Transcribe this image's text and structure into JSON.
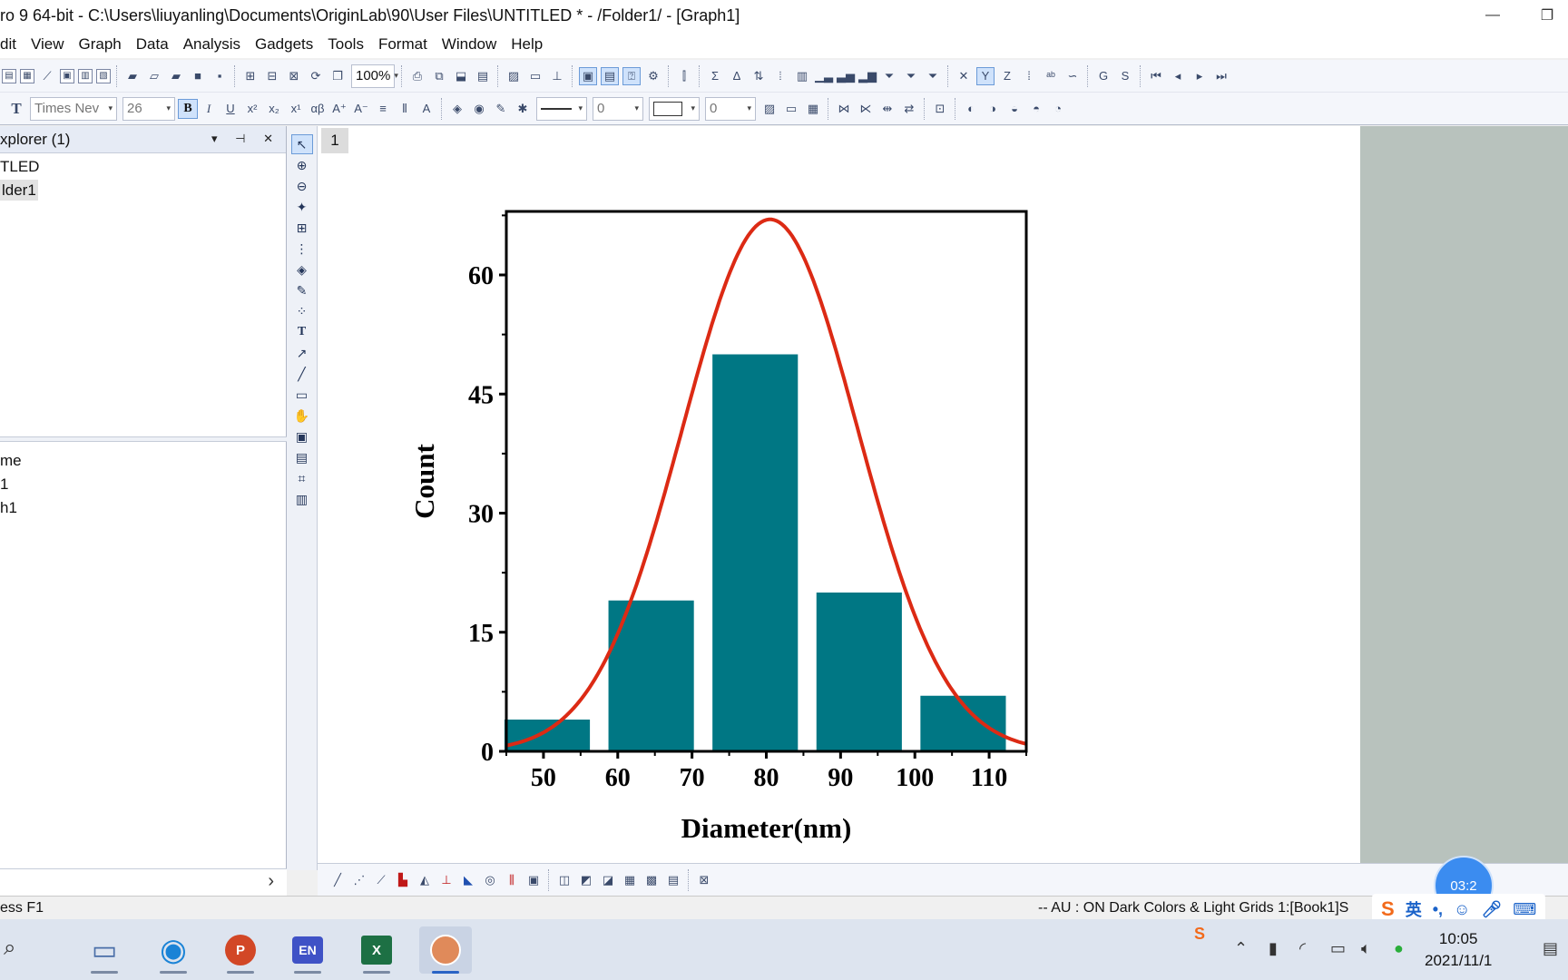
{
  "window": {
    "title": "ro 9 64-bit - C:\\Users\\liuyanling\\Documents\\OriginLab\\90\\User Files\\UNTITLED * - /Folder1/ - [Graph1]",
    "minimize_glyph": "—",
    "restore_glyph": "❐"
  },
  "menu": [
    "dit",
    "View",
    "Graph",
    "Data",
    "Analysis",
    "Gadgets",
    "Tools",
    "Format",
    "Window",
    "Help"
  ],
  "toolbar": {
    "zoom_value": "100%",
    "font_name": "Times Nev",
    "font_size": "26",
    "bold_label": "B",
    "line_width_value": "0",
    "fill_value": "0"
  },
  "explorer": {
    "title": "xplorer (1)",
    "controls": "▾ ⊣ ✕",
    "tree": [
      {
        "label": "TLED",
        "selected": false
      },
      {
        "label": "lder1",
        "selected": true
      }
    ],
    "list_items": [
      "me",
      "1",
      "h1"
    ]
  },
  "graph": {
    "layer_tab": "1"
  },
  "chart_data": {
    "type": "bar",
    "title": "",
    "xlabel": "Diameter(nm)",
    "ylabel": "Count",
    "categories": [
      "50",
      "64",
      "78",
      "92",
      "106"
    ],
    "x_centers": [
      50.5,
      64.5,
      78.5,
      92.5,
      106.5
    ],
    "values": [
      4,
      19,
      50,
      20,
      7
    ],
    "bar_width": 11.5,
    "xlim": [
      45,
      115
    ],
    "ylim": [
      0,
      68
    ],
    "x_ticks": [
      50,
      60,
      70,
      80,
      90,
      100,
      110
    ],
    "y_ticks": [
      0,
      15,
      30,
      45,
      60
    ],
    "bar_color": "#007784",
    "fit": {
      "type": "gaussian",
      "color": "#dc2a14",
      "peak": 67,
      "center": 80.5,
      "sigma": 11.8
    },
    "grid": false,
    "legend": "none"
  },
  "status": {
    "left": "ess F1",
    "right": "-- AU : ON Dark Colors & Light Grids 1:[Book1]S"
  },
  "taskbar": {
    "time": "10:05",
    "date": "2021/11/1",
    "apps": [
      "computer-icon",
      "edge-icon",
      "powerpoint-icon",
      "en-dictionary-icon",
      "excel-icon",
      "origin-icon"
    ]
  },
  "recorder": {
    "timer": "03:2"
  },
  "ime": {
    "lang": "英"
  }
}
